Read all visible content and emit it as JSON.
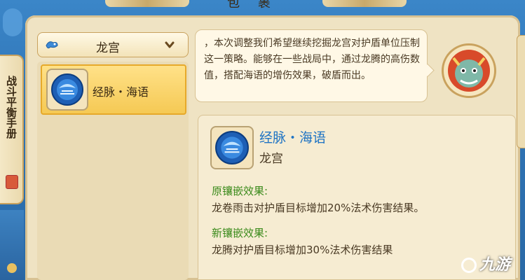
{
  "window": {
    "title": "包 裹"
  },
  "side_tab": {
    "label": "战斗平衡手册"
  },
  "dropdown": {
    "selected": "龙宫",
    "icon": "dragon-cloud-icon",
    "chevron": "chevron-down-icon"
  },
  "list": {
    "items": [
      {
        "name": "经脉・海语",
        "icon": "jingmai-disc-icon"
      }
    ]
  },
  "bubble": {
    "text": "，本次调整我们希望继续挖掘龙宫对护盾单位压制这一策略。能够在一些战局中，通过龙腾的高伤数值，搭配海语的增伤效果，破盾而出。"
  },
  "detail": {
    "name": "经脉・海语",
    "school": "龙宫",
    "old_title": "原镶嵌效果:",
    "old_body": "龙卷雨击对护盾目标增加20%法术伤害结果。",
    "new_title": "新镶嵌效果:",
    "new_body": "龙腾对护盾目标增加30%法术伤害结果"
  },
  "watermark": {
    "text": "九游"
  },
  "colors": {
    "panel": "#efe3c3",
    "frame": "#2f74b6",
    "highlight": "#f5c954",
    "name_blue": "#1f74c4",
    "section_green": "#3a8a1a"
  }
}
